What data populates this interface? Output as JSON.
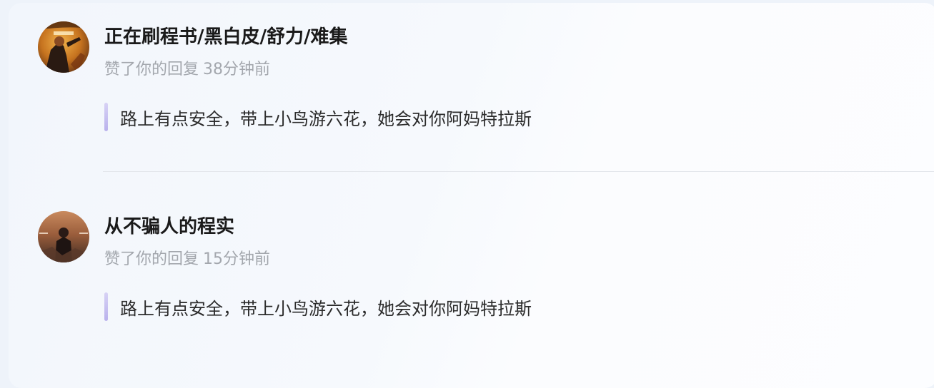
{
  "notifications": [
    {
      "username": "正在刷程书/黑白皮/舒力/难集",
      "action": "赞了你的回复",
      "time": "38分钟前",
      "quote": "路上有点安全，带上小鸟游六花，她会对你阿妈特拉斯",
      "avatar_icon": "book-cover-avatar-icon"
    },
    {
      "username": "从不骗人的程实",
      "action": "赞了你的回复",
      "time": "15分钟前",
      "quote": "路上有点安全，带上小鸟游六花，她会对你阿妈特拉斯",
      "avatar_icon": "movie-poster-avatar-icon"
    }
  ],
  "colors": {
    "accent_bar": "#b9b1ec",
    "meta_text": "#a3a7ad",
    "title_text": "#1a1a1a"
  }
}
